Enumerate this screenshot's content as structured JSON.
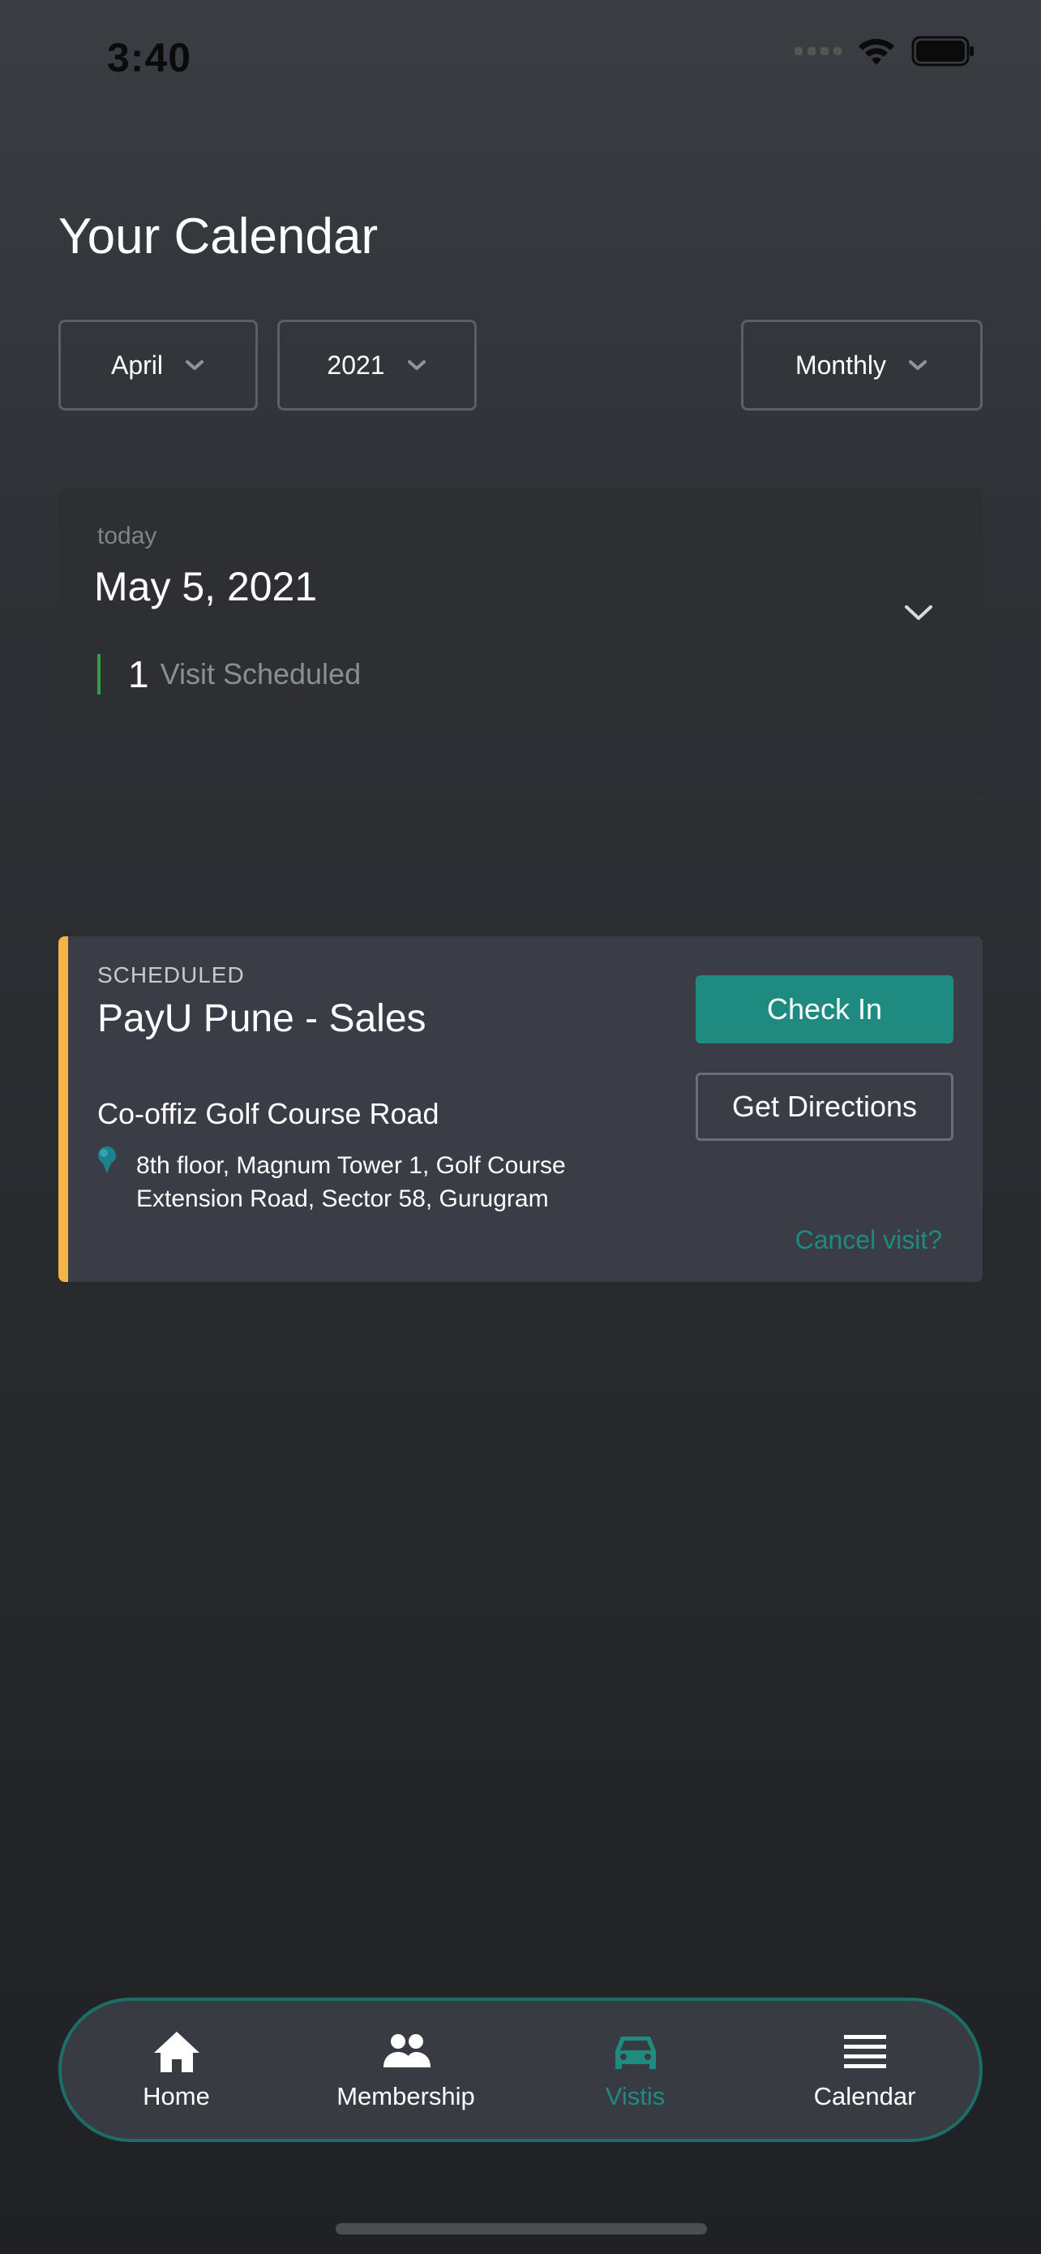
{
  "status_bar": {
    "time": "3:40"
  },
  "header": {
    "title": "Your Calendar"
  },
  "filters": {
    "month": "April",
    "year": "2021",
    "view_mode": "Monthly"
  },
  "today_card": {
    "label": "today",
    "date": "May 5, 2021",
    "visit_count": "1",
    "visit_text": "Visit Scheduled"
  },
  "visit": {
    "status": "SCHEDULED",
    "title": "PayU Pune - Sales",
    "venue": "Co-offiz Golf Course Road",
    "address": "8th floor, Magnum Tower 1, Golf Course Extension Road, Sector 58, Gurugram",
    "check_in_label": "Check In",
    "directions_label": "Get Directions",
    "cancel_label": "Cancel visit?",
    "accent_color": "#f5b546"
  },
  "tabbar": {
    "items": [
      {
        "label": "Home",
        "icon": "home-icon",
        "active": false
      },
      {
        "label": "Membership",
        "icon": "people-icon",
        "active": false
      },
      {
        "label": "Vistis",
        "icon": "car-icon",
        "active": true
      },
      {
        "label": "Calendar",
        "icon": "menu-lines-icon",
        "active": false
      }
    ]
  },
  "colors": {
    "accent": "#1f8a80",
    "scheduled_accent": "#f5b546",
    "visit_indicator": "#2ea043"
  }
}
